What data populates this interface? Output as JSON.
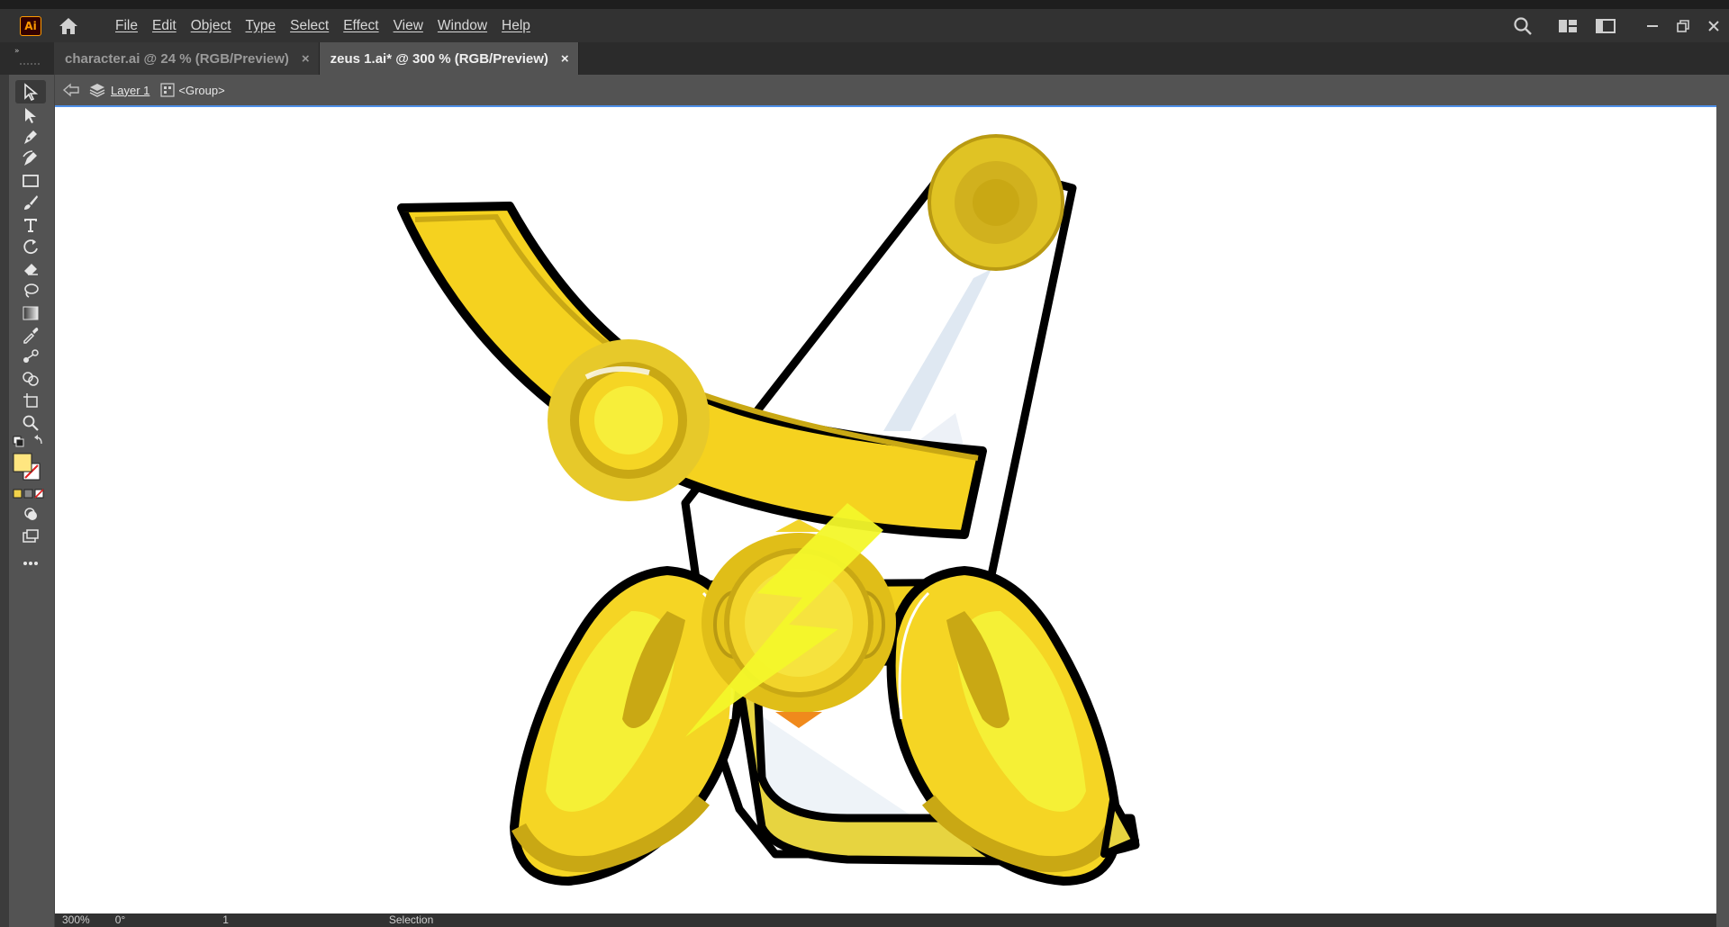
{
  "app": {
    "logo_text": "Ai",
    "menus": [
      "File",
      "Edit",
      "Object",
      "Type",
      "Select",
      "Effect",
      "View",
      "Window",
      "Help"
    ]
  },
  "tabs": [
    {
      "label": "character.ai @ 24 % (RGB/Preview)",
      "active": false
    },
    {
      "label": "zeus 1.ai* @ 300 % (RGB/Preview)",
      "active": true
    }
  ],
  "breadcrumb": {
    "layer": "Layer 1",
    "group": "<Group>"
  },
  "status": {
    "zoom": "300%",
    "rotation": "0°",
    "artboard": "1",
    "tool": "Selection"
  },
  "colors": {
    "fill_swatch": "#ffe680",
    "gold": "#f5d222",
    "gold_dark": "#c9a814",
    "bolt": "#f3f52a",
    "outline": "#000000"
  },
  "tabs_close_glyph": "×"
}
